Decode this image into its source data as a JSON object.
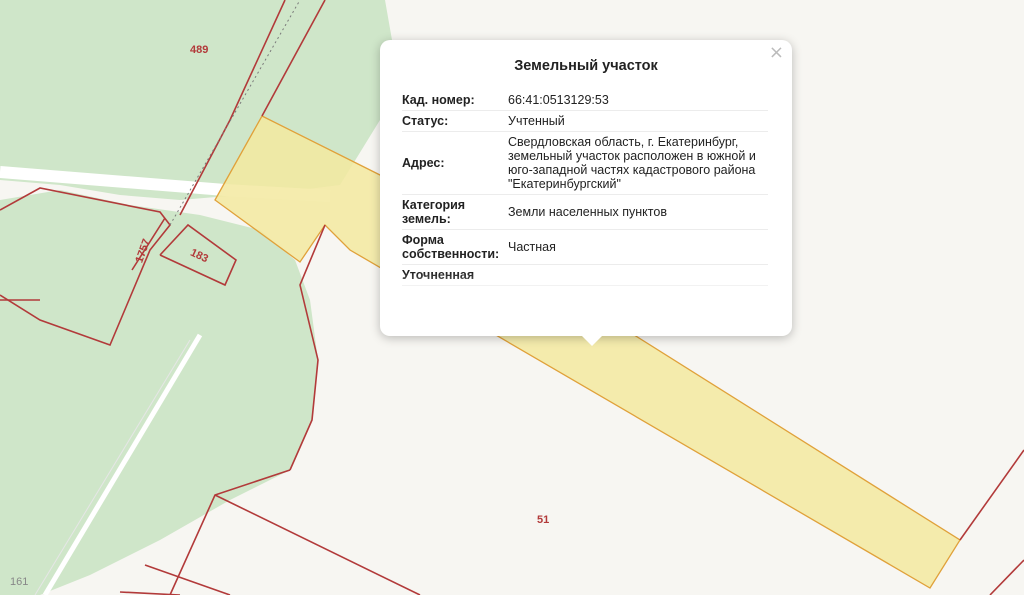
{
  "map": {
    "parcel_numbers": [
      "489",
      "1757",
      "183",
      "51",
      "161"
    ]
  },
  "popup": {
    "title": "Земельный участок",
    "close_symbol": "×",
    "rows": [
      {
        "key": "Кад. номер:",
        "value": "66:41:0513129:53"
      },
      {
        "key": "Статус:",
        "value": "Учтенный"
      },
      {
        "key": "Адрес:",
        "value": "Свердловская область, г. Екатеринбург, земельный участок расположен в южной и юго-западной частях кадастрового района \"Екатеринбургский\""
      },
      {
        "key": "Категория земель:",
        "value": "Земли населенных пунктов"
      },
      {
        "key": "Форма собственности:",
        "value": "Частная"
      },
      {
        "key": "Уточненная",
        "value": ""
      }
    ]
  }
}
